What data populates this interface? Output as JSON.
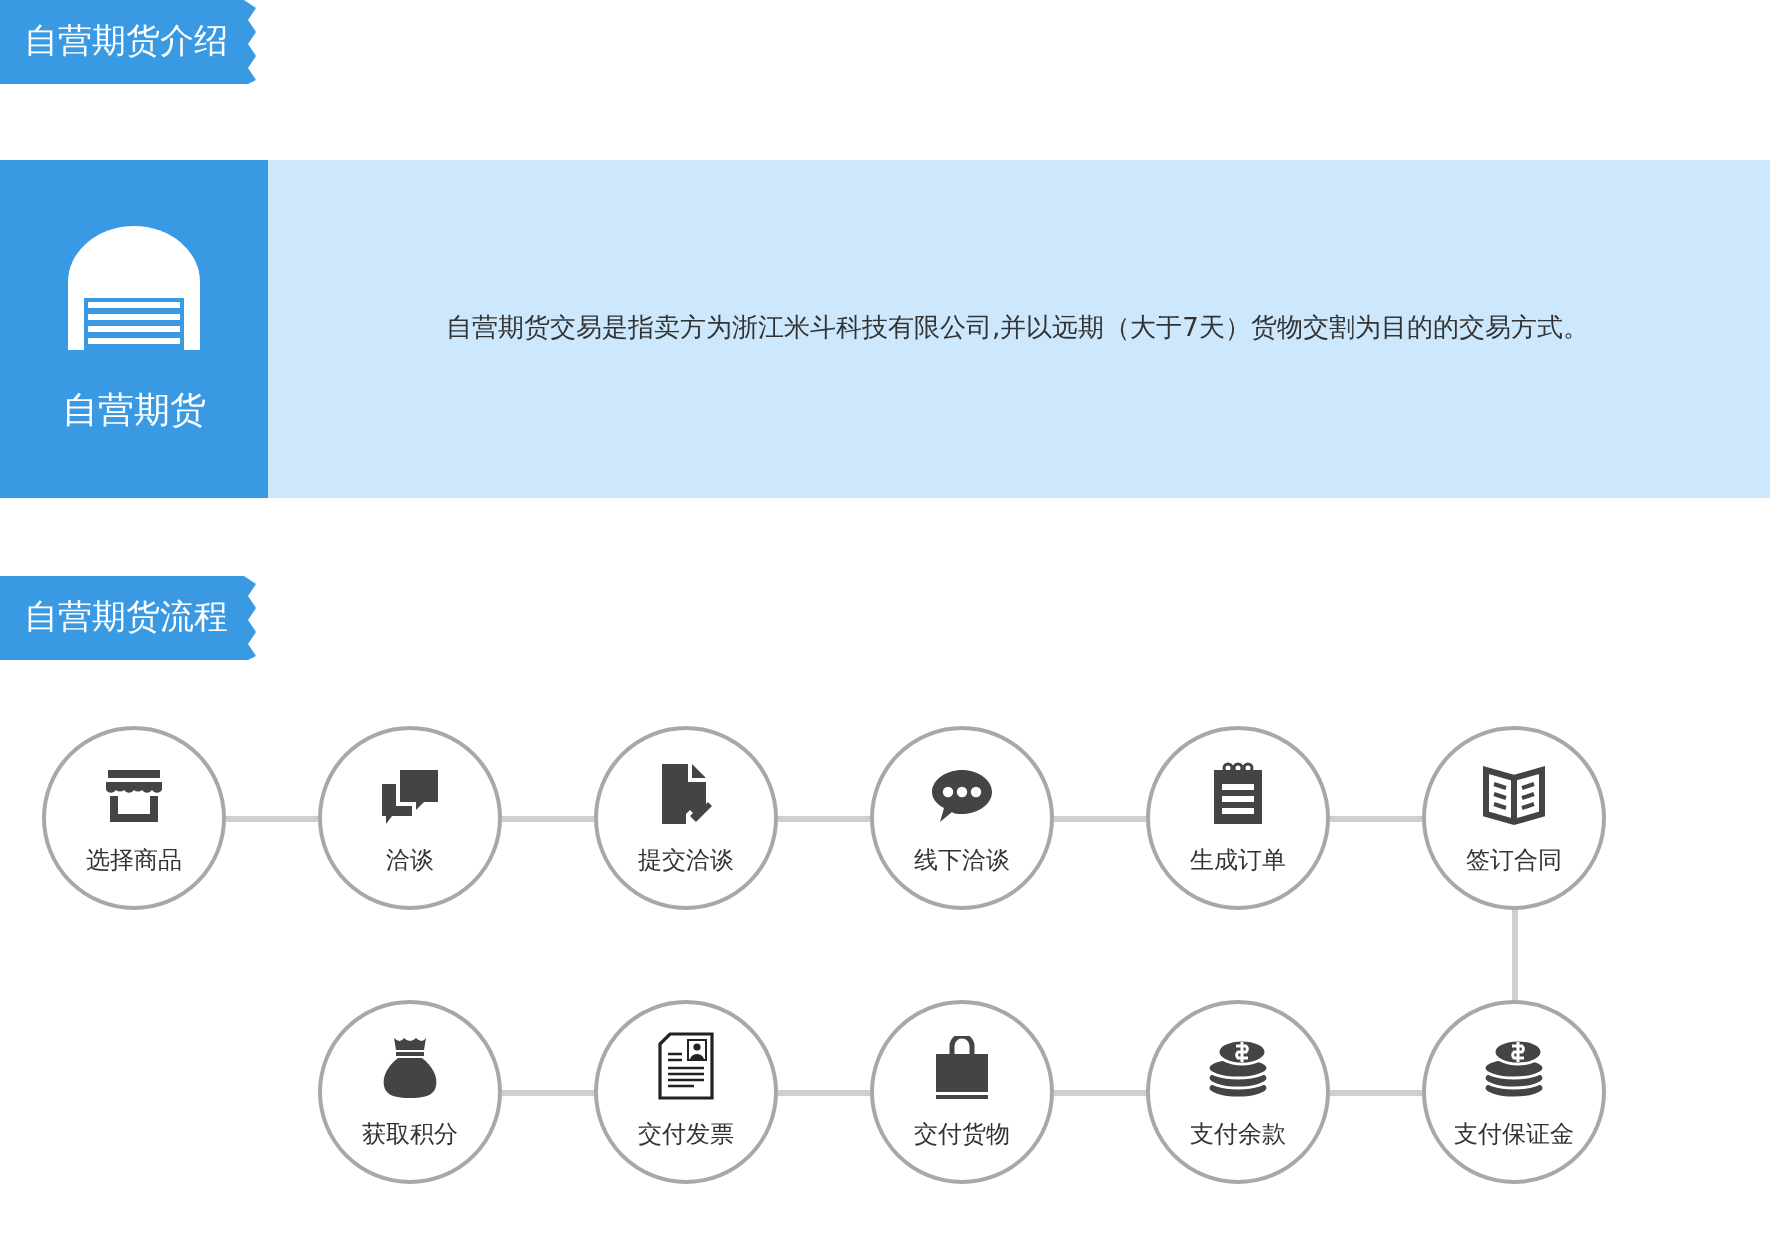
{
  "intro_heading": "自营期货介绍",
  "intro": {
    "title": "自营期货",
    "description": "自营期货交易是指卖方为浙江米斗科技有限公司,并以远期（大于7天）货物交割为目的的交易方式。"
  },
  "process_heading": "自营期货流程",
  "steps": [
    {
      "label": "选择商品"
    },
    {
      "label": "洽谈"
    },
    {
      "label": "提交洽谈"
    },
    {
      "label": "线下洽谈"
    },
    {
      "label": "生成订单"
    },
    {
      "label": "签订合同"
    },
    {
      "label": "获取积分"
    },
    {
      "label": "交付发票"
    },
    {
      "label": "交付货物"
    },
    {
      "label": "支付余款"
    },
    {
      "label": "支付保证金"
    }
  ]
}
